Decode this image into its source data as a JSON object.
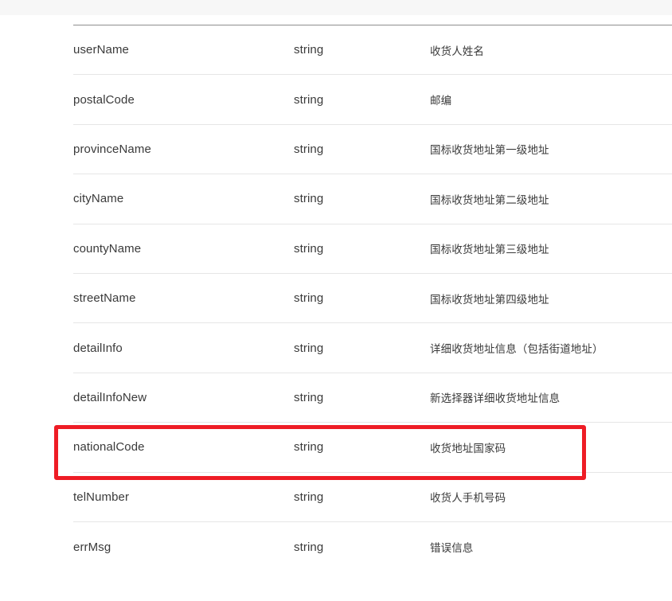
{
  "table": {
    "rows": [
      {
        "name": "userName",
        "type": "string",
        "desc": "收货人姓名"
      },
      {
        "name": "postalCode",
        "type": "string",
        "desc": "邮编"
      },
      {
        "name": "provinceName",
        "type": "string",
        "desc": "国标收货地址第一级地址"
      },
      {
        "name": "cityName",
        "type": "string",
        "desc": "国标收货地址第二级地址"
      },
      {
        "name": "countyName",
        "type": "string",
        "desc": "国标收货地址第三级地址"
      },
      {
        "name": "streetName",
        "type": "string",
        "desc": "国标收货地址第四级地址"
      },
      {
        "name": "detailInfo",
        "type": "string",
        "desc": "详细收货地址信息（包括街道地址）"
      },
      {
        "name": "detailInfoNew",
        "type": "string",
        "desc": "新选择器详细收货地址信息"
      },
      {
        "name": "nationalCode",
        "type": "string",
        "desc": "收货地址国家码"
      },
      {
        "name": "telNumber",
        "type": "string",
        "desc": "收货人手机号码"
      },
      {
        "name": "errMsg",
        "type": "string",
        "desc": "错误信息"
      }
    ]
  },
  "highlight": {
    "row_name": "nationalCode",
    "color": "#ee1c25"
  }
}
